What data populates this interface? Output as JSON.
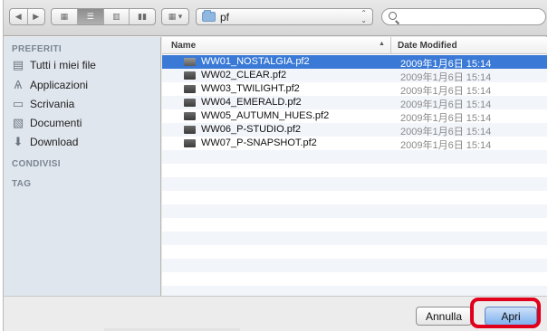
{
  "toolbar": {
    "current_folder": "pf"
  },
  "sidebar": {
    "favorites_heading": "PREFERITI",
    "favorites": [
      {
        "label": "Tutti i miei file",
        "icon": "all-files-icon"
      },
      {
        "label": "Applicazioni",
        "icon": "applications-icon"
      },
      {
        "label": "Scrivania",
        "icon": "desktop-icon"
      },
      {
        "label": "Documenti",
        "icon": "documents-icon"
      },
      {
        "label": "Download",
        "icon": "download-icon"
      }
    ],
    "shared_heading": "CONDIVISI",
    "tags_heading": "TAG"
  },
  "list": {
    "col_name": "Name",
    "col_date": "Date Modified",
    "files": [
      {
        "name": "WW01_NOSTALGIA.pf2",
        "date": "2009年1月6日 15:14",
        "selected": true
      },
      {
        "name": "WW02_CLEAR.pf2",
        "date": "2009年1月6日 15:14",
        "selected": false
      },
      {
        "name": "WW03_TWILIGHT.pf2",
        "date": "2009年1月6日 15:14",
        "selected": false
      },
      {
        "name": "WW04_EMERALD.pf2",
        "date": "2009年1月6日 15:14",
        "selected": false
      },
      {
        "name": "WW05_AUTUMN_HUES.pf2",
        "date": "2009年1月6日 15:14",
        "selected": false
      },
      {
        "name": "WW06_P-STUDIO.pf2",
        "date": "2009年1月6日 15:14",
        "selected": false
      },
      {
        "name": "WW07_P-SNAPSHOT.pf2",
        "date": "2009年1月6日 15:14",
        "selected": false
      }
    ]
  },
  "buttons": {
    "cancel": "Annulla",
    "open": "Apri"
  },
  "colors": {
    "selection": "#3a7ad6",
    "highlight_ring": "#e0001b"
  }
}
